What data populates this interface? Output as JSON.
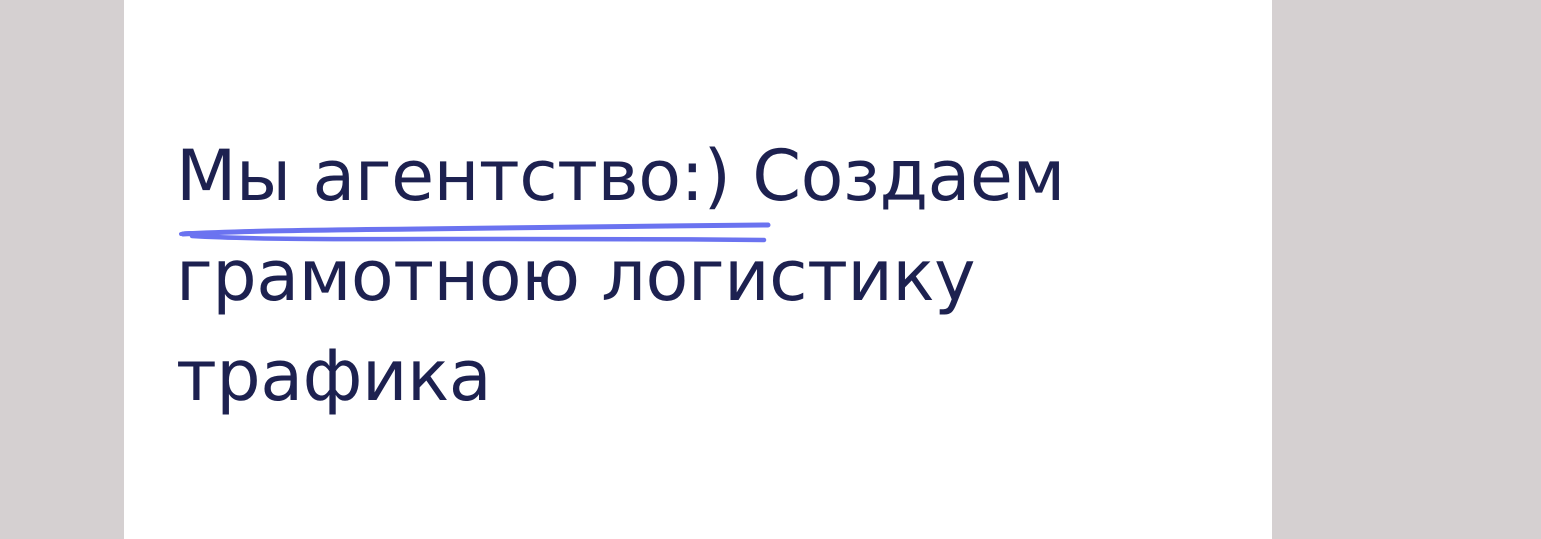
{
  "headline": {
    "highlighted": "Мы агентство:)",
    "line1_rest": " Создаем",
    "line2": "грамотною логистику",
    "line3": "трафика"
  },
  "colors": {
    "background": "#d5d0d1",
    "panel": "#ffffff",
    "text": "#1d2150",
    "underline": "#6b73f0"
  },
  "underline_style": "hand-drawn-marker"
}
